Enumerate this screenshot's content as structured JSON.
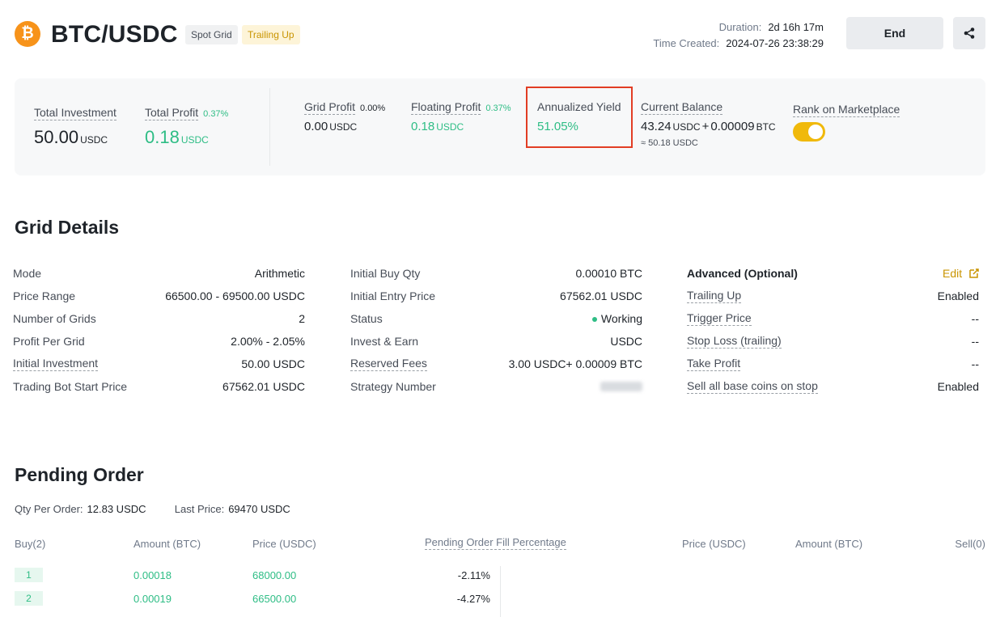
{
  "header": {
    "pair": "BTC/USDC",
    "coin_symbol": "₿",
    "tags": [
      "Spot Grid",
      "Trailing Up"
    ],
    "duration_label": "Duration:",
    "duration_value": "2d 16h 17m",
    "created_label": "Time Created:",
    "created_value": "2024-07-26 23:38:29",
    "end_label": "End",
    "share_icon": "share-icon"
  },
  "summary": {
    "total_investment": {
      "label": "Total Investment",
      "value": "50.00",
      "unit": "USDC"
    },
    "total_profit": {
      "label": "Total Profit",
      "pct": "0.37%",
      "value": "0.18",
      "unit": "USDC"
    },
    "grid_profit": {
      "label": "Grid Profit",
      "pct": "0.00%",
      "value": "0.00",
      "unit": "USDC"
    },
    "floating_profit": {
      "label": "Floating Profit",
      "pct": "0.37%",
      "value": "0.18",
      "unit": "USDC"
    },
    "annualized_yield": {
      "label": "Annualized Yield",
      "value": "51.05%"
    },
    "current_balance": {
      "label": "Current Balance",
      "usdc": "43.24",
      "usdc_unit": "USDC",
      "plus": "+",
      "btc": "0.00009",
      "btc_unit": "BTC",
      "approx": "≈ 50.18 USDC"
    },
    "rank": {
      "label": "Rank on Marketplace",
      "enabled": true
    }
  },
  "grid_details": {
    "title": "Grid Details",
    "col1": [
      {
        "k": "Mode",
        "v": "Arithmetic"
      },
      {
        "k": "Price Range",
        "v": "66500.00 - 69500.00 USDC"
      },
      {
        "k": "Number of Grids",
        "v": "2"
      },
      {
        "k": "Profit Per Grid",
        "v": "2.00% - 2.05%"
      },
      {
        "k": "Initial Investment",
        "v": "50.00 USDC"
      },
      {
        "k": "Trading Bot Start Price",
        "v": "67562.01 USDC"
      }
    ],
    "col2": [
      {
        "k": "Initial Buy Qty",
        "v": "0.00010 BTC"
      },
      {
        "k": "Initial Entry Price",
        "v": "67562.01 USDC"
      },
      {
        "k": "Status",
        "v": "Working"
      },
      {
        "k": "Invest & Earn",
        "v": "USDC"
      },
      {
        "k": "Reserved Fees",
        "v": "3.00 USDC+ 0.00009 BTC"
      },
      {
        "k": "Strategy Number",
        "v": ""
      }
    ],
    "col3": {
      "heading": "Advanced (Optional)",
      "edit": "Edit",
      "rows": [
        {
          "k": "Trailing Up",
          "v": "Enabled"
        },
        {
          "k": "Trigger Price",
          "v": "--"
        },
        {
          "k": "Stop Loss (trailing)",
          "v": "--"
        },
        {
          "k": "Take Profit",
          "v": "--"
        },
        {
          "k": "Sell all base coins on stop",
          "v": "Enabled"
        }
      ]
    }
  },
  "pending": {
    "title": "Pending Order",
    "qty_label": "Qty Per Order:",
    "qty_value": "12.83 USDC",
    "last_label": "Last Price:",
    "last_value": "69470 USDC",
    "headers": {
      "buy": "Buy(2)",
      "amount_left": "Amount (BTC)",
      "price_left": "Price (USDC)",
      "fill": "Pending Order Fill Percentage",
      "price_right": "Price (USDC)",
      "amount_right": "Amount (BTC)",
      "sell": "Sell(0)"
    },
    "buy_rows": [
      {
        "idx": "1",
        "amount": "0.00018",
        "price": "68000.00",
        "fill": "-2.11%"
      },
      {
        "idx": "2",
        "amount": "0.00019",
        "price": "66500.00",
        "fill": "-4.27%"
      }
    ]
  }
}
